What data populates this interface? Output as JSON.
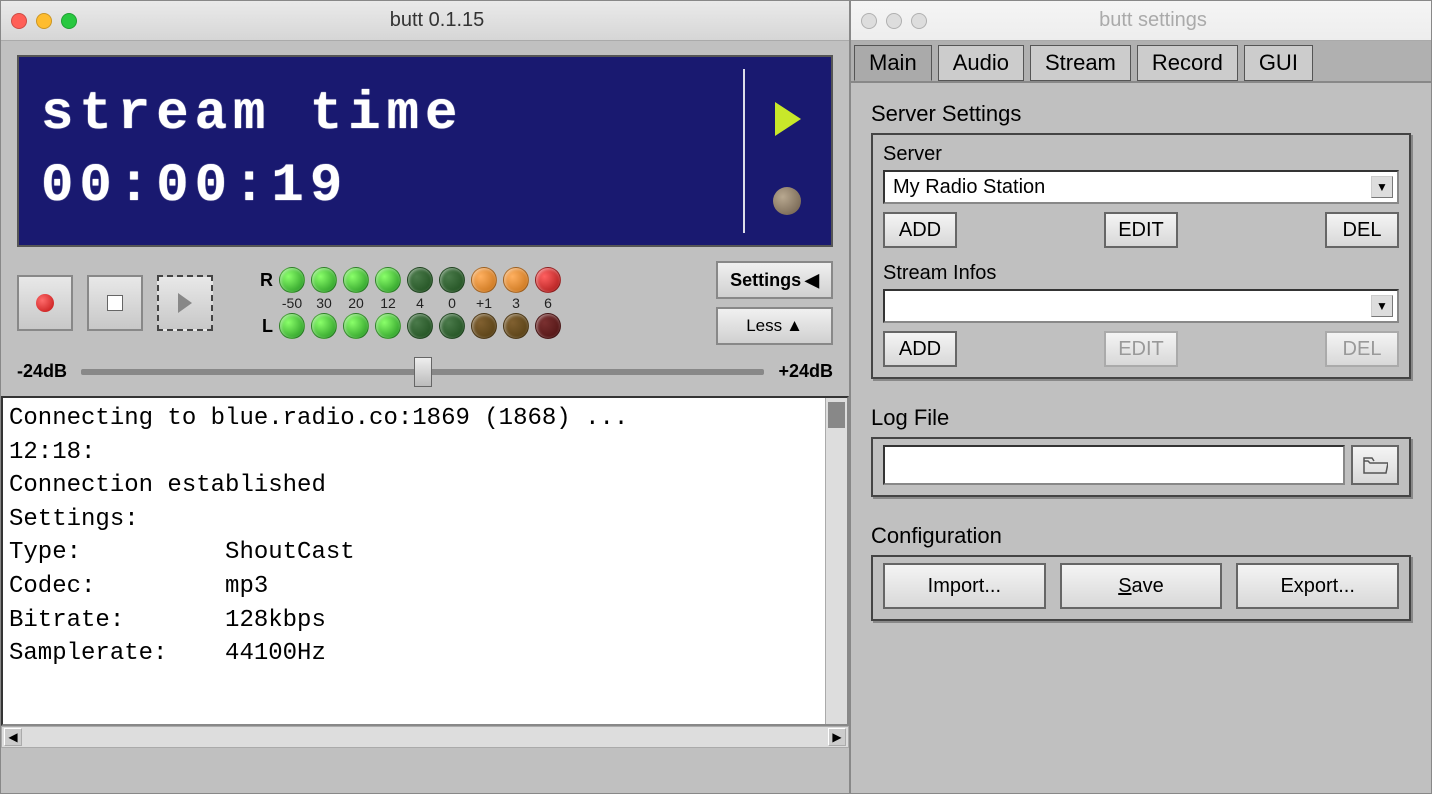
{
  "main_window": {
    "title": "butt 0.1.15",
    "lcd_line1": "stream time",
    "lcd_line2": "00:00:19",
    "vu_labels": {
      "right": "R",
      "left": "L"
    },
    "vu_scale": [
      "-50",
      "30",
      "20",
      "12",
      "4",
      "0",
      "+1",
      "3",
      "6"
    ],
    "settings_btn": "Settings",
    "less_btn": "Less",
    "slider_min": "-24dB",
    "slider_max": "+24dB",
    "log": "Connecting to blue.radio.co:1869 (1868) ...\n12:18:\nConnection established\nSettings:\nType:          ShoutCast\nCodec:         mp3\nBitrate:       128kbps\nSamplerate:    44100Hz"
  },
  "settings_window": {
    "title": "butt settings",
    "tabs": [
      "Main",
      "Audio",
      "Stream",
      "Record",
      "GUI"
    ],
    "active_tab": "Main",
    "server_settings_label": "Server Settings",
    "server_label": "Server",
    "server_value": "My Radio Station",
    "add": "ADD",
    "edit": "EDIT",
    "del": "DEL",
    "stream_infos_label": "Stream Infos",
    "stream_infos_value": "",
    "log_file_label": "Log File",
    "log_file_value": "",
    "configuration_label": "Configuration",
    "import": "Import...",
    "save": "Save",
    "export": "Export..."
  }
}
